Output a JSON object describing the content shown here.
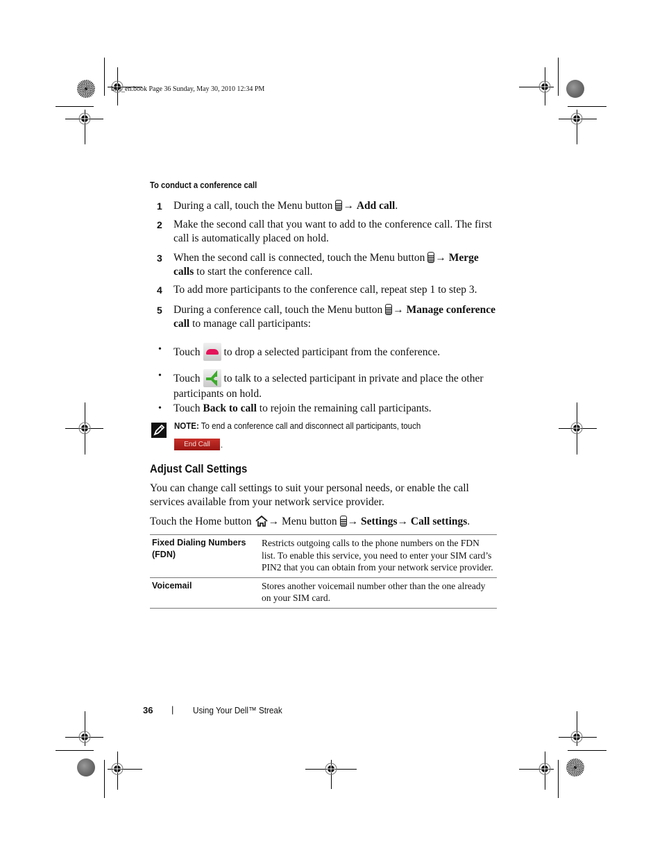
{
  "print_header": "bk0_en.book  Page 36  Sunday, May 30, 2010  12:34 PM",
  "subheading": "To conduct a conference call",
  "steps": [
    {
      "num": "1",
      "pre": "During a call, touch the Menu button",
      "icon": "menu-icon",
      "arrow": "→",
      "bold": "Add call",
      "post": "."
    },
    {
      "num": "2",
      "text": "Make the second call that you want to add to the conference call. The first call is automatically placed on hold."
    },
    {
      "num": "3",
      "pre": "When the second call is connected, touch the Menu button",
      "icon": "menu-icon",
      "arrow": "→",
      "bold": "Merge calls",
      "post": " to start the conference call."
    },
    {
      "num": "4",
      "text": "To add more participants to the conference call, repeat step 1 to step 3."
    },
    {
      "num": "5",
      "pre": "During a conference call, touch the Menu button",
      "icon": "menu-icon",
      "arrow": "→",
      "bold": "Manage conference call",
      "post": " to manage call participants:"
    }
  ],
  "bullets": [
    {
      "marker": "•",
      "pre": "Touch",
      "icon": "drop-participant-icon",
      "post": "to drop a selected participant from the conference."
    },
    {
      "marker": "•",
      "pre": "Touch",
      "icon": "private-call-icon",
      "post": "to talk to a selected participant in private and place the other participants on hold."
    },
    {
      "marker": "•",
      "pre": "Touch ",
      "bold": "Back to call",
      "post": " to rejoin the remaining call participants."
    }
  ],
  "note": {
    "label": "NOTE:",
    "text": " To end a conference call and disconnect all participants, touch",
    "button_label": "End Call",
    "end": "."
  },
  "section": {
    "title": "Adjust Call Settings",
    "intro": "You can change call settings to suit your personal needs, or enable the call services available from your network service provider.",
    "path": {
      "pre": "Touch the Home button",
      "arrow1": "→",
      "mid": " Menu button",
      "arrow2": "→",
      "b1": " Settings",
      "arrow3": "→",
      "b2": " Call settings",
      "end": "."
    }
  },
  "table": {
    "rows": [
      {
        "setting": "Fixed Dialing Numbers (FDN)",
        "description": "Restricts outgoing calls to the phone numbers on the FDN list. To enable this service, you need to enter your SIM card’s PIN2 that you can obtain from your network service provider."
      },
      {
        "setting": "Voicemail",
        "description": "Stores another voicemail number other than the one already on your SIM card."
      }
    ]
  },
  "footer": {
    "page_number": "36",
    "separator": "|",
    "title": "Using Your Dell™ Streak"
  }
}
